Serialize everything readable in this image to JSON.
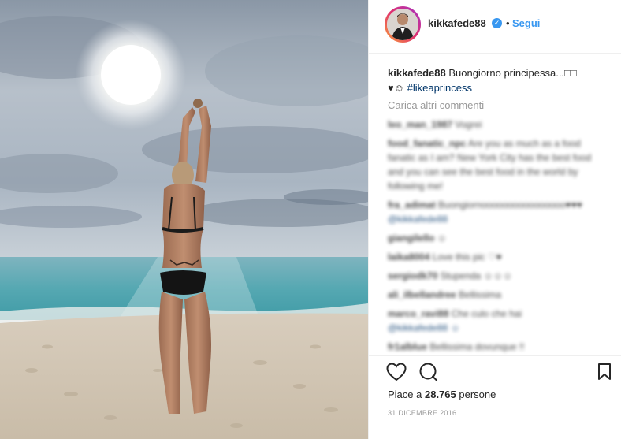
{
  "post": {
    "username": "kikkafede88",
    "dot": "•",
    "follow_label": "Segui",
    "caption_text": " Buongiorno principessa...□□",
    "caption_emoji": "♥☺",
    "hashtag": " #likeaprincess",
    "load_more": "Carica altri commenti"
  },
  "comments": [
    {
      "user": "leo_man_1987",
      "text": " Vogrei",
      "mention": ""
    },
    {
      "user": "food_fanatic_npc",
      "text": " Are you as much as a food fanatic as I am? New York City has the best food and you can see the best food in the world by following me!",
      "mention": ""
    },
    {
      "user": "fra_adimat",
      "text": " Buongiornoooooooooooooooo♥♥♥",
      "mention": "@kikkafede88"
    },
    {
      "user": "giangilello",
      "text": " ☺",
      "mention": ""
    },
    {
      "user": "laika8004",
      "text": " Love this pic ♡♥",
      "mention": ""
    },
    {
      "user": "sergiodk70",
      "text": " Stupenda ☺☺☺",
      "mention": ""
    },
    {
      "user": "ali_ilbellandree",
      "text": " Bellissima",
      "mention": ""
    },
    {
      "user": "marco_ravi88",
      "text": " Che culo che hai",
      "mention": "@kikkafede88 ☺"
    },
    {
      "user": "fr1alblue",
      "text": " Bellissima dovunque !!",
      "mention": ""
    }
  ],
  "footer": {
    "likes_prefix": "Piace a ",
    "likes_count": "28.765",
    "likes_suffix": " persone",
    "date": "31 DICEMBRE 2016"
  },
  "icons": [
    "heart-icon",
    "comment-icon",
    "bookmark-icon",
    "verified-badge-icon"
  ],
  "colors": {
    "link": "#3897f0",
    "hashtag": "#003569",
    "muted": "#999999",
    "badge": "#3897f0"
  }
}
